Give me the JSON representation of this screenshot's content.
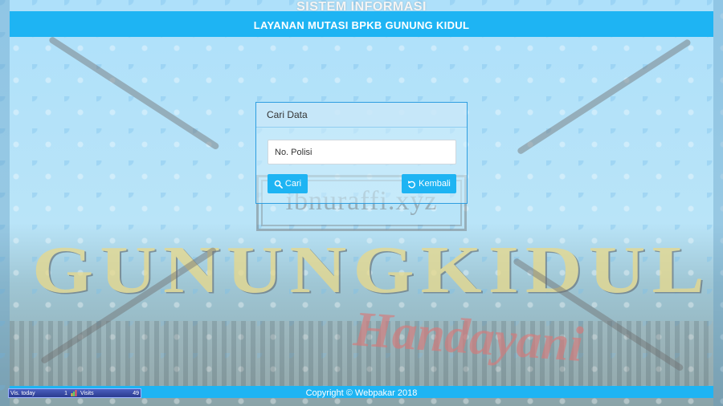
{
  "header": {
    "site_title": "SISTEM INFORMASI",
    "subtitle": "LAYANAN MUTASI BPKB GUNUNG KIDUL"
  },
  "background": {
    "sign_text": "GUNUNGKIDUL",
    "sign_subtext": "Handayani",
    "watermark": "ibnuraffi.xyz"
  },
  "search_panel": {
    "heading": "Cari Data",
    "input_placeholder": "No. Polisi",
    "search_button": "Cari",
    "back_button": "Kembali"
  },
  "footer": {
    "copyright": "Copyright © Webpakar 2018"
  },
  "visit_counter": {
    "today_label": "Vis. today",
    "today_value": "1",
    "visits_label": "Visits",
    "visits_value": "49"
  },
  "colors": {
    "accent": "#1eb4f3",
    "panel_border": "#2f9ee0"
  },
  "icons": {
    "search": "search-icon",
    "back": "undo-icon",
    "counter": "chart-icon"
  }
}
